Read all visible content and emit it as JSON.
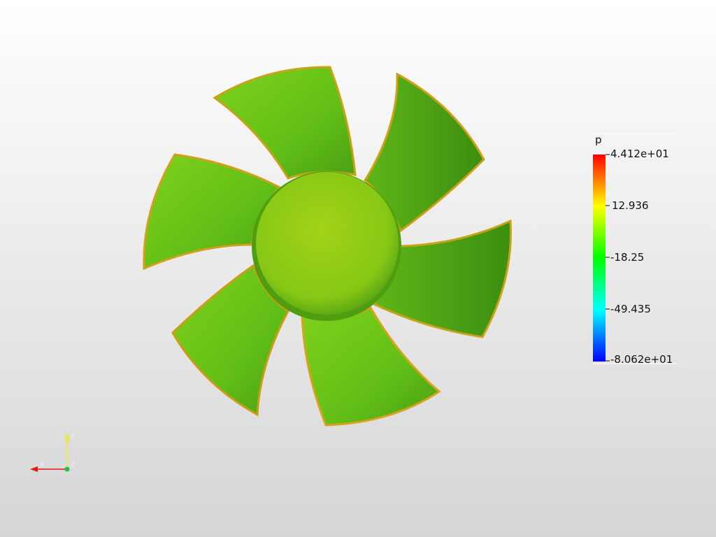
{
  "scalar_bar": {
    "title": "p",
    "max_label": "4.412e+01",
    "tick_2": "12.936",
    "tick_3": "-18.25",
    "tick_4": "-49.435",
    "min_label": "-8.062e+01",
    "range": [
      -80.62,
      44.12
    ],
    "colors": [
      "#0000ff",
      "#00ffff",
      "#00ff00",
      "#ffff00",
      "#ff0000"
    ]
  },
  "orientation_axes": {
    "x_label": "X",
    "y_label": "Y",
    "z_label": "Z",
    "x_color": "#e8151c",
    "y_color": "#f0e640",
    "z_color": "#20c040"
  },
  "model": {
    "name": "fan",
    "blade_count": 6,
    "blade_color": "#6cc51a",
    "hub_color": "#8fcf16",
    "edge_color": "#c9a316"
  }
}
